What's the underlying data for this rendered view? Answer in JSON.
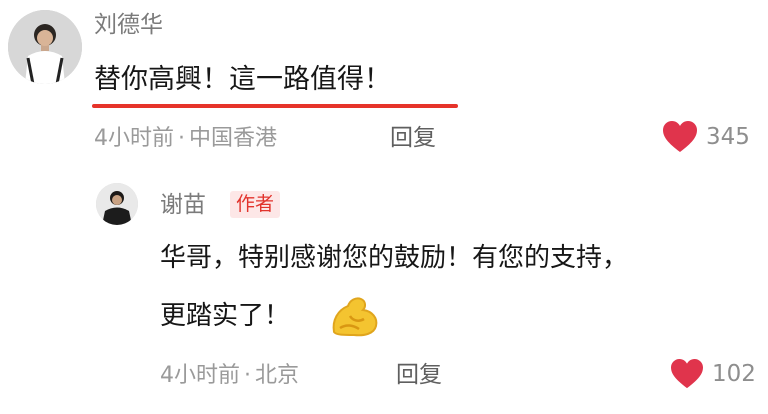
{
  "comment": {
    "username": "刘德华",
    "text": "替你高興！這一路值得！",
    "time": "4小时前",
    "location": "中国香港",
    "reply_label": "回复",
    "likes": "345"
  },
  "reply": {
    "username": "谢苗",
    "author_badge": "作者",
    "text_line1": "华哥，特别感谢您的鼓励！有您的支持，",
    "text_line2": "更踏实了！",
    "emoji": "muscle-icon",
    "time": "4小时前",
    "location": "北京",
    "reply_label": "回复",
    "likes": "102"
  },
  "colors": {
    "accent_red": "#e6332a",
    "heart": "#e0344c",
    "badge_bg": "#fde7e7"
  }
}
